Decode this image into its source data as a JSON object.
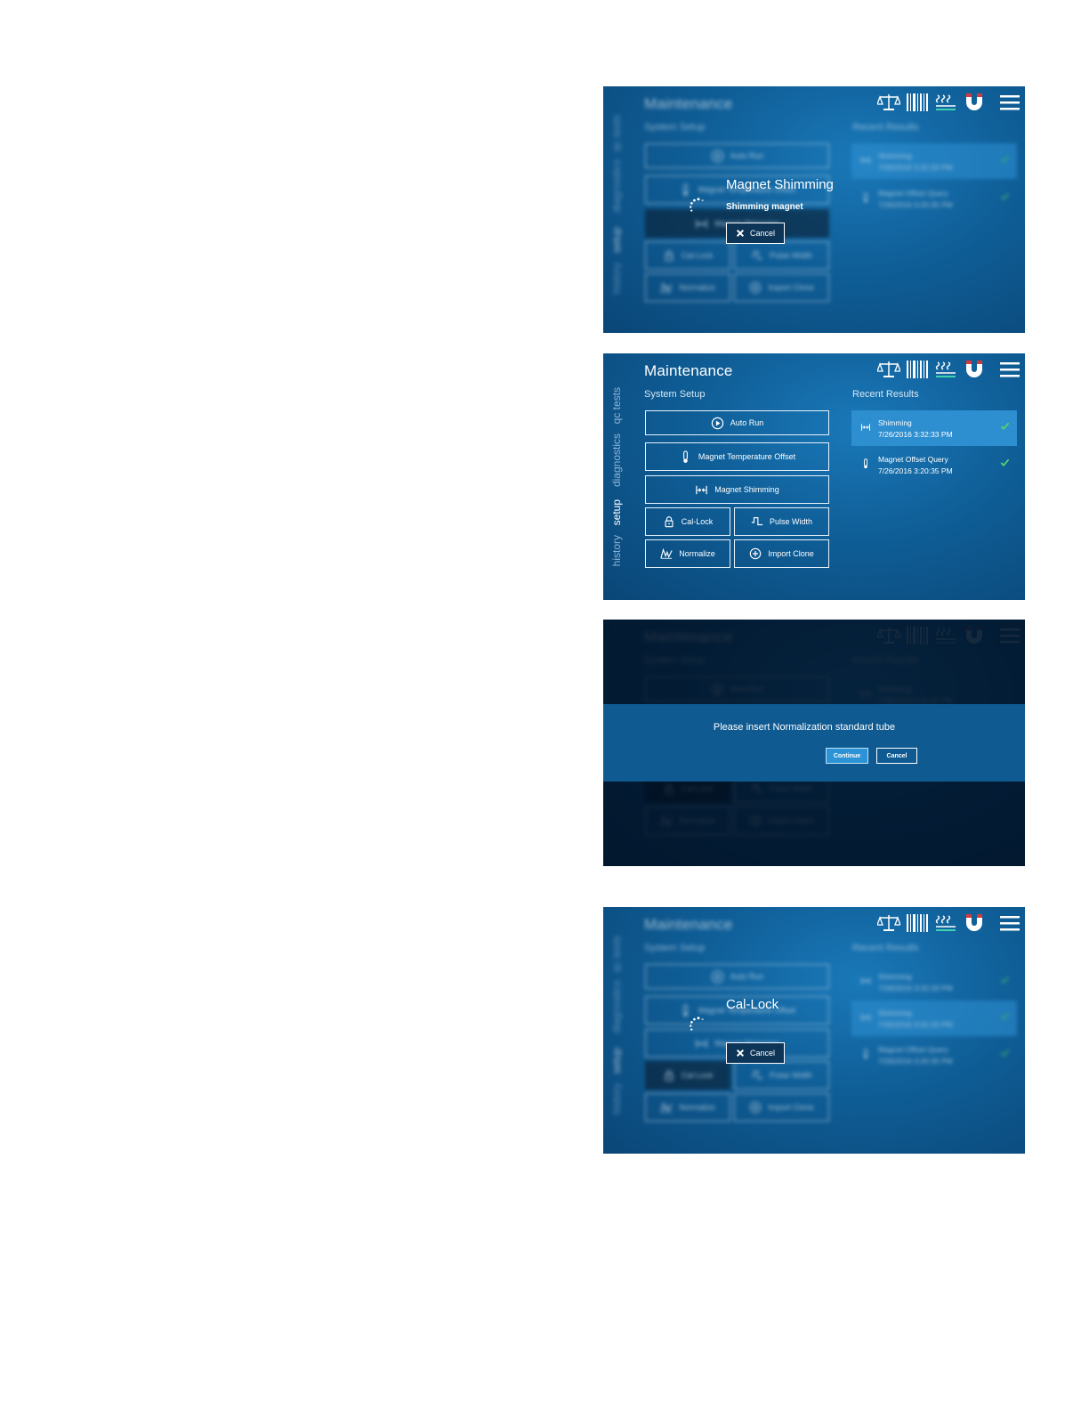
{
  "app": {
    "title": "Maintenance",
    "section": "System Setup",
    "recent_title": "Recent Results",
    "nav": [
      "history",
      "setup",
      "diagnostics",
      "qc tests"
    ],
    "active_nav": "setup",
    "header_icons": [
      "balance-icon",
      "barcode-icon",
      "heat-icon",
      "magnet-icon",
      "menu-icon"
    ]
  },
  "buttons": {
    "auto_run": "Auto Run",
    "magnet_temp": "Magnet Temperature Offset",
    "magnet_shimming": "Magnet Shimming",
    "cal_lock": "Cal-Lock",
    "pulse_width": "Pulse Width",
    "normalize": "Normalize",
    "import_clone": "Import Clone"
  },
  "results": [
    {
      "name": "Shimming",
      "time": "7/26/2016 3:32:33 PM"
    },
    {
      "name": "Magnet Offset Query",
      "time": "7/26/2016 3:20:35 PM"
    }
  ],
  "shimming_overlay": {
    "title": "Magnet Shimming",
    "status": "Shimming magnet",
    "cancel": "Cancel"
  },
  "normalize_dialog": {
    "message": "Please insert Normalization standard tube",
    "continue": "Continue",
    "cancel": "Cancel"
  },
  "callock_overlay": {
    "title": "Cal-Lock",
    "cancel": "Cancel"
  },
  "colors": {
    "accent": "#2d8ed0",
    "check": "#56d36b",
    "panel_bg": "#0f5e97"
  }
}
